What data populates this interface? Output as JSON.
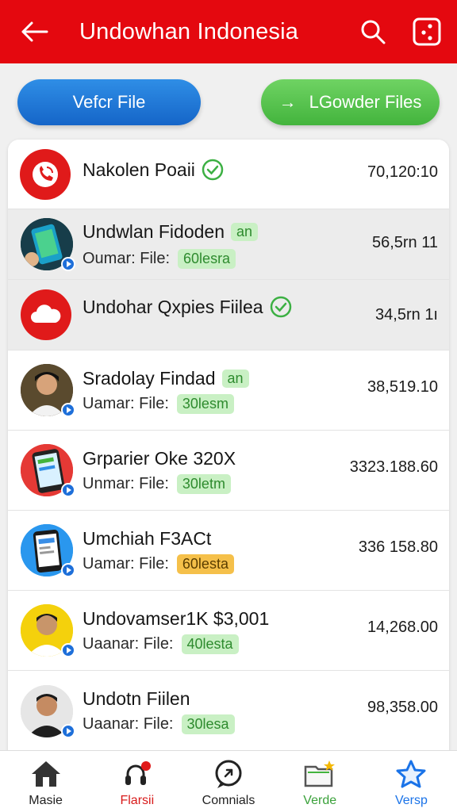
{
  "header": {
    "title": "Undowhan Indonesia",
    "bg_color": "#e4080f"
  },
  "actions": {
    "primary_label": "Vefcr File",
    "secondary_label": "LGowder Files"
  },
  "rows": [
    {
      "name": "Nakolen Poaii",
      "verified": true,
      "value": "70,120:10",
      "avatar": "phone-icon"
    },
    {
      "name": "Undwlan Fidoden",
      "name_tag": "an",
      "sub_label": "Oumar: File:",
      "sub_tag": "60lesra",
      "value": "56,5rn 11",
      "avatar": "phone-app-image"
    },
    {
      "name": "Undohar Qxpies Fiilea",
      "verified": true,
      "value": "34,5rn 1ı",
      "avatar": "cloud-icon"
    },
    {
      "name": "Sradolay Findad",
      "name_tag": "an",
      "sub_label": "Uamar: File:",
      "sub_tag": "30lesm",
      "value": "38,519.10",
      "avatar": "person-photo"
    },
    {
      "name": "Grparier Oke 320X",
      "sub_label": "Unmar: File:",
      "sub_tag": "30letm",
      "value": "3323.188.60",
      "avatar": "smartphone-image"
    },
    {
      "name": "Umchiah F3ACt",
      "sub_label": "Uamar: File:",
      "sub_tag": "60lesta",
      "sub_tag_color": "orange",
      "value": "336 158.80",
      "avatar": "smartphone-image"
    },
    {
      "name": "Undovamser1K $3,001",
      "sub_label": "Uaanar: File:",
      "sub_tag": "40lesta",
      "value": "14,268.00",
      "avatar": "person-photo"
    },
    {
      "name": "Undotn Fiilen",
      "sub_label": "Uaanar: File:",
      "sub_tag": "30lesa",
      "value": "98,358.00",
      "avatar": "person-photo"
    }
  ],
  "bottom_nav": [
    {
      "label": "Masie",
      "icon": "home-icon",
      "color": "#222222"
    },
    {
      "label": "Flarsii",
      "icon": "headset-icon",
      "color": "#d81b1b"
    },
    {
      "label": "Comnials",
      "icon": "chat-icon",
      "color": "#222222"
    },
    {
      "label": "Verde",
      "icon": "folder-star-icon",
      "color": "#3aa13a"
    },
    {
      "label": "Versp",
      "icon": "star-icon",
      "color": "#1a73e8"
    }
  ]
}
